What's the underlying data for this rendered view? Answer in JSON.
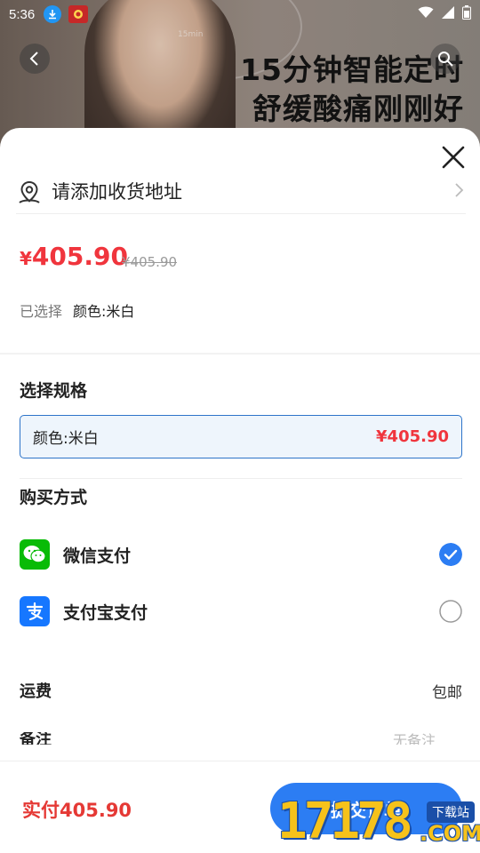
{
  "status_bar": {
    "time": "5:36"
  },
  "banner": {
    "line1": "15分钟智能定时",
    "line2": "舒缓酸痛刚刚好",
    "small_text": "15min"
  },
  "address": {
    "text": "请添加收货地址"
  },
  "price": {
    "currency": "¥",
    "current": "405.90",
    "original": "¥405.90"
  },
  "selected": {
    "label": "已选择",
    "value": "颜色:米白"
  },
  "spec": {
    "title": "选择规格",
    "options": [
      {
        "name": "颜色:米白",
        "price": "¥405.90",
        "selected": true
      }
    ]
  },
  "payment": {
    "title": "购买方式",
    "methods": [
      {
        "label": "微信支付",
        "icon": "wechat-pay-icon",
        "selected": true,
        "color": "#09bb07"
      },
      {
        "label": "支付宝支付",
        "icon": "alipay-icon",
        "selected": false,
        "color": "#1677ff"
      }
    ]
  },
  "shipping": {
    "label": "运费",
    "value": "包邮"
  },
  "remark": {
    "label": "备注",
    "placeholder": "无备注"
  },
  "footer": {
    "total": "实付405.90",
    "submit_label": "提交订单"
  },
  "watermark": {
    "digits": "17178",
    "domain": ".COM",
    "tag": "下载站"
  },
  "colors": {
    "accent": "#2c7df3",
    "price_red": "#f0353d",
    "spec_border": "#2d74c9"
  }
}
